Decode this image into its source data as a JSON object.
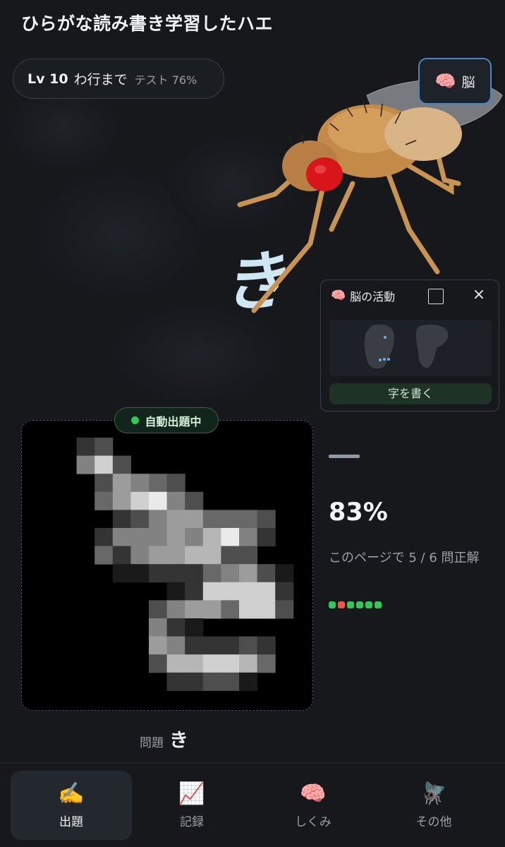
{
  "header": {
    "title": "ひらがな読み書き学習したハエ"
  },
  "level": {
    "lv": "Lv 10",
    "range": "わ行まで",
    "test": "テスト 76%"
  },
  "brain_button": {
    "icon": "🧠",
    "label": "脳"
  },
  "fly_char": "き",
  "activity_panel": {
    "icon": "🧠",
    "title": "脳の活動",
    "close": "×",
    "write_button": "字を書く"
  },
  "canvas": {
    "badge": "自動出題中"
  },
  "prompt": {
    "label": "問題",
    "char": "き"
  },
  "result": {
    "predicted": "—",
    "confidence": "83%",
    "score_text": "このページで 5 / 6 問正解",
    "history": [
      "correct",
      "wrong",
      "correct",
      "correct",
      "correct",
      "correct"
    ]
  },
  "colors": {
    "correct": "#34c759",
    "wrong": "#ef5350",
    "accent": "#4a86c7"
  },
  "tabs": [
    {
      "icon": "✍️",
      "label": "出題",
      "active": true
    },
    {
      "icon": "📈",
      "label": "記録",
      "active": false
    },
    {
      "icon": "🧠",
      "label": "しくみ",
      "active": false
    },
    {
      "icon": "🪰",
      "label": "その他",
      "active": false
    }
  ]
}
